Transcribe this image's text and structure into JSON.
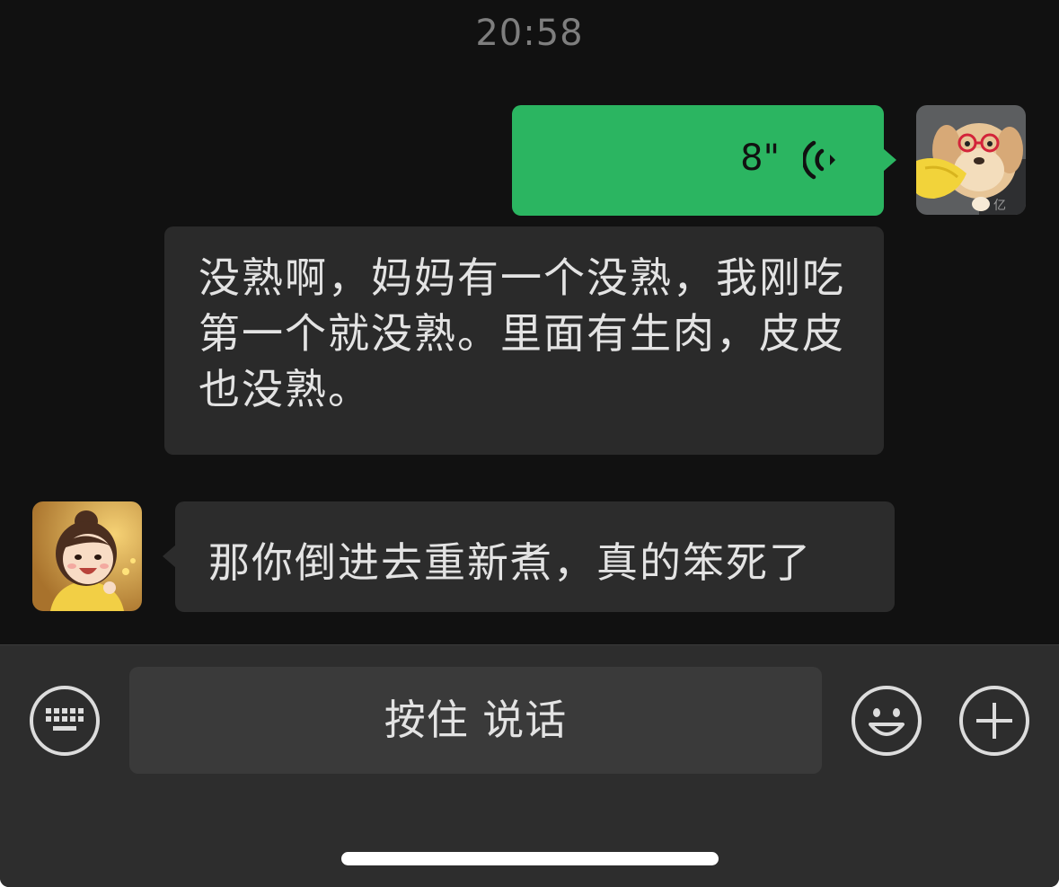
{
  "status": {
    "time": "20:58"
  },
  "messages": [
    {
      "direction": "outgoing",
      "type": "voice",
      "duration": "8\"",
      "avatar_icon": "puppy-avatar",
      "bubble_color": "#2bb561"
    },
    {
      "direction": "outgoing",
      "type": "voice-transcript",
      "text": "没熟啊，妈妈有一个没熟，我刚吃第一个就没熟。里面有生肉，皮皮也没熟。"
    },
    {
      "direction": "incoming",
      "type": "text",
      "text": "那你倒进去重新煮，真的笨死了",
      "avatar_icon": "girl-avatar"
    }
  ],
  "input_bar": {
    "left_icon": "keyboard-icon",
    "hold_to_talk_label": "按住 说话",
    "emoji_icon": "emoji-icon",
    "plus_icon": "plus-icon"
  },
  "theme": {
    "background": "#111111",
    "bubble_incoming": "#2c2c2c",
    "accent_green": "#2bb561"
  }
}
